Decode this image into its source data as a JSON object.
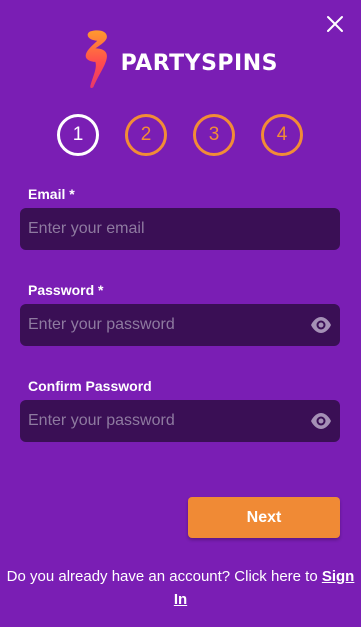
{
  "app": {
    "brand": "PARTYSPINS"
  },
  "steps": [
    {
      "label": "1",
      "active": true
    },
    {
      "label": "2",
      "active": false
    },
    {
      "label": "3",
      "active": false
    },
    {
      "label": "4",
      "active": false
    }
  ],
  "form": {
    "email": {
      "label": "Email *",
      "placeholder": "Enter your email",
      "value": ""
    },
    "password": {
      "label": "Password *",
      "placeholder": "Enter your password",
      "value": ""
    },
    "confirm": {
      "label": "Confirm Password",
      "placeholder": "Enter your password",
      "value": ""
    }
  },
  "actions": {
    "next_label": "Next"
  },
  "footer": {
    "prompt": "Do you already have an account? Click here to",
    "signin_label": "Sign In"
  },
  "icons": {
    "close": "close-icon",
    "eye": "eye-icon",
    "logo": "lightning-bolt-icon"
  },
  "colors": {
    "background": "#7a1eb4",
    "field": "#3a0f55",
    "accent": "#f08a35",
    "active_step": "#ffffff"
  }
}
